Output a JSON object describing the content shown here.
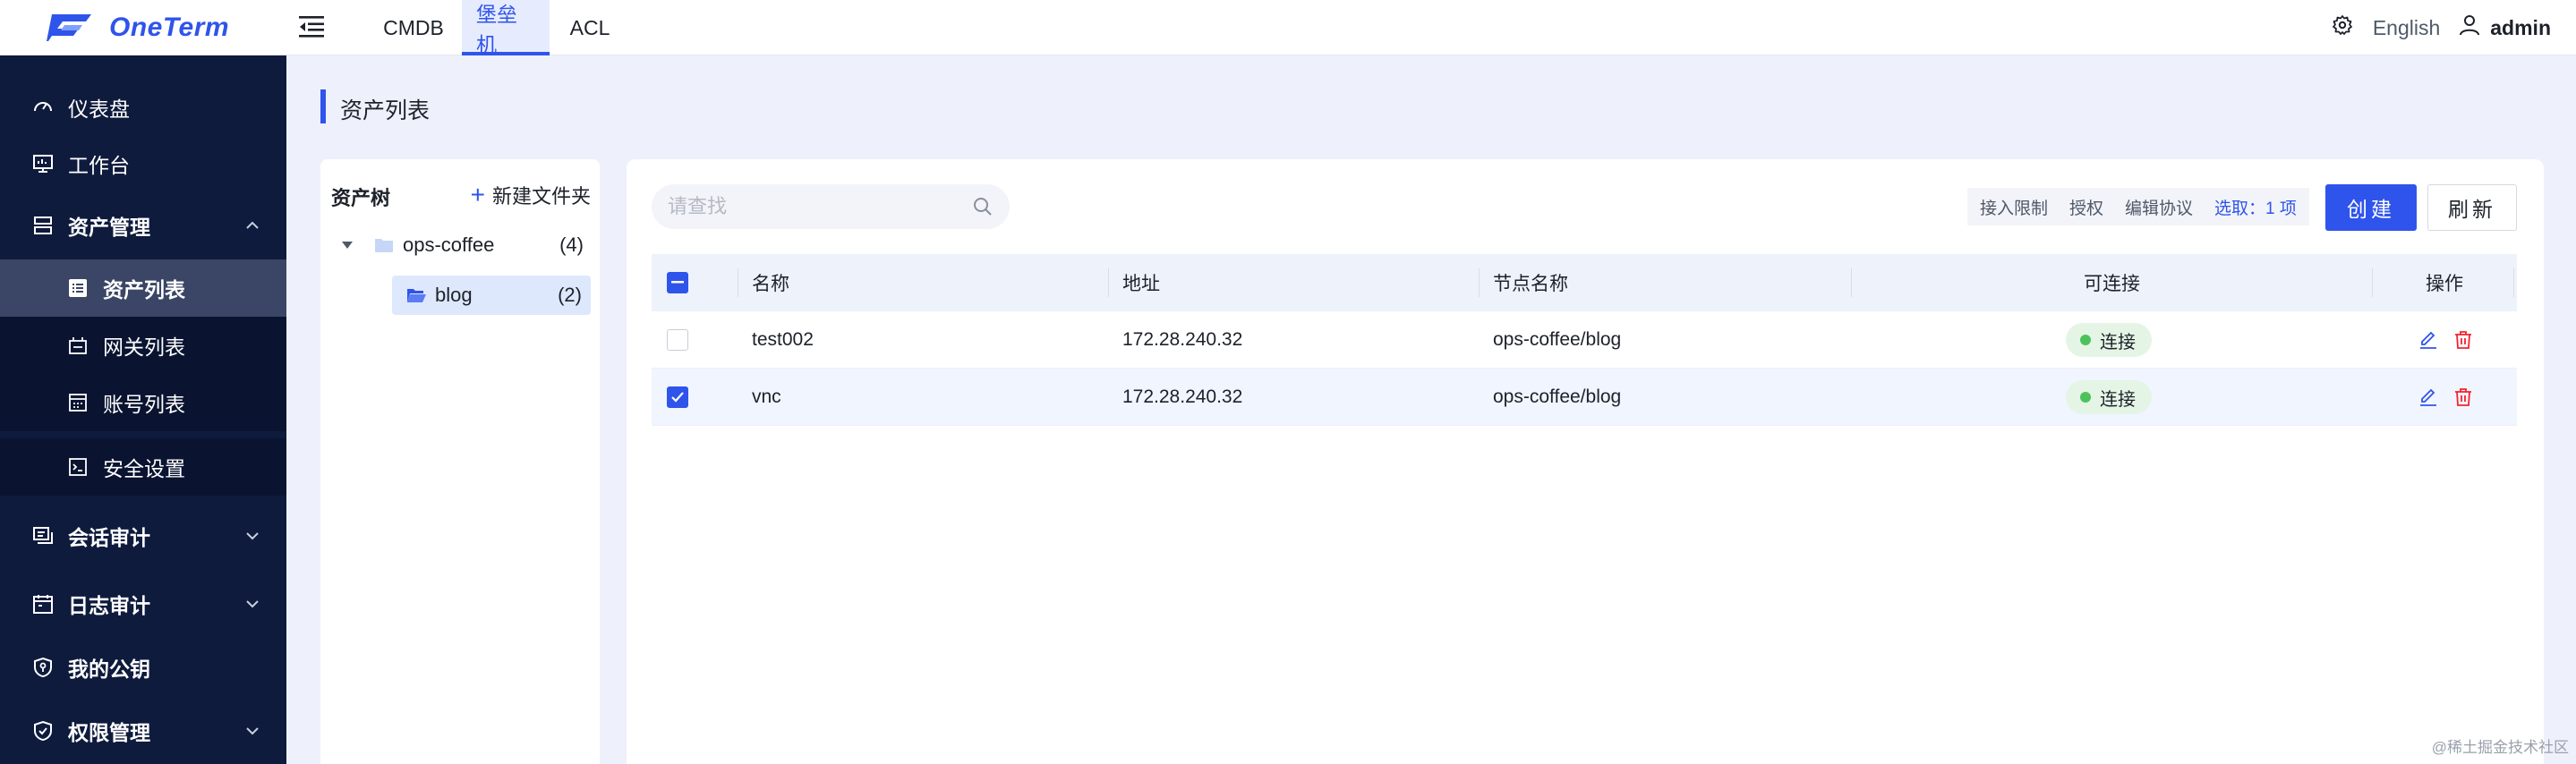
{
  "app": {
    "name": "OneTerm"
  },
  "nav": {
    "tabs": [
      {
        "label": "CMDB"
      },
      {
        "label": "堡垒机"
      },
      {
        "label": "ACL"
      }
    ]
  },
  "header": {
    "language": "English",
    "username": "admin"
  },
  "sidebar": {
    "items": [
      {
        "label": "仪表盘",
        "icon": "dashboard-icon"
      },
      {
        "label": "工作台",
        "icon": "workbench-icon"
      },
      {
        "label": "资产管理",
        "icon": "server-icon"
      },
      {
        "label": "资产列表",
        "icon": "list-icon"
      },
      {
        "label": "网关列表",
        "icon": "gateway-icon"
      },
      {
        "label": "账号列表",
        "icon": "account-icon"
      },
      {
        "label": "安全设置",
        "icon": "terminal-icon"
      },
      {
        "label": "会话审计",
        "icon": "session-icon"
      },
      {
        "label": "日志审计",
        "icon": "calendar-icon"
      },
      {
        "label": "我的公钥",
        "icon": "key-shield-icon"
      },
      {
        "label": "权限管理",
        "icon": "shield-check-icon"
      }
    ]
  },
  "page": {
    "title": "资产列表"
  },
  "tree": {
    "header": "资产树",
    "new_folder": "新建文件夹",
    "nodes": [
      {
        "label": "ops-coffee",
        "count": "(4)"
      },
      {
        "label": "blog",
        "count": "(2)"
      }
    ]
  },
  "toolbar": {
    "search_placeholder": "请查找",
    "actions": {
      "access_limit": "接入限制",
      "authorize": "授权",
      "edit_protocol": "编辑协议",
      "selected": "选取：1 项"
    },
    "create": "创建",
    "refresh": "刷新"
  },
  "table": {
    "columns": [
      "名称",
      "地址",
      "节点名称",
      "可连接",
      "操作"
    ],
    "rows": [
      {
        "name": "test002",
        "address": "172.28.240.32",
        "node": "ops-coffee/blog",
        "status": "连接",
        "checked": false
      },
      {
        "name": "vnc",
        "address": "172.28.240.32",
        "node": "ops-coffee/blog",
        "status": "连接",
        "checked": true
      }
    ]
  },
  "colors": {
    "accent": "#2f54eb",
    "sidebar_bg": "#0f1b3d",
    "status_ok": "#4cc35a",
    "danger": "#f5222d"
  },
  "watermark": "@稀土掘金技术社区"
}
